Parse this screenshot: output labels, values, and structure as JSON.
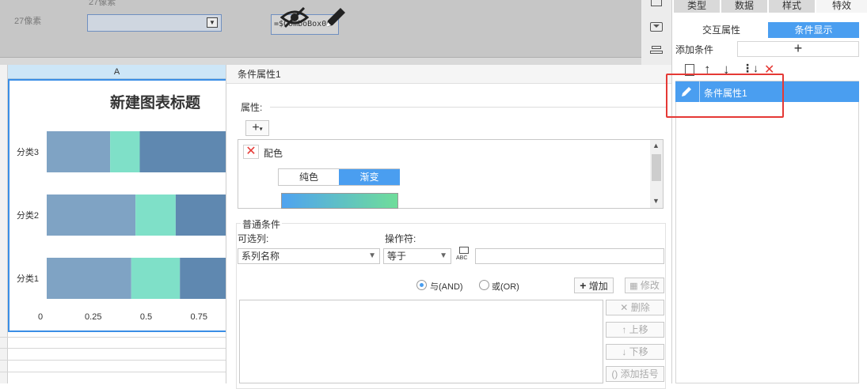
{
  "top_editor": {
    "row_height_label": "27像素",
    "top_label": "27像素",
    "combobox_value": "=$ComboBox0"
  },
  "sheet": {
    "column_header": "A"
  },
  "chart_data": {
    "type": "bar",
    "orientation": "horizontal",
    "stacked": true,
    "title": "新建图表标题",
    "categories": [
      "分类1",
      "分类2",
      "分类3"
    ],
    "x_ticks": [
      "0",
      "0.25",
      "0.5",
      "0.75"
    ],
    "xlim": [
      0,
      1
    ],
    "series": [
      {
        "values": [
          0.4,
          0.42,
          0.3
        ],
        "color": "#7fa3c4"
      },
      {
        "values": [
          0.23,
          0.19,
          0.14
        ],
        "color": "#7fe0c8"
      },
      {
        "values": [
          0.37,
          0.39,
          0.56
        ],
        "color": "#5f88b0"
      }
    ]
  },
  "dialog": {
    "title": "条件属性1",
    "attributes_label": "属性:",
    "add_icon": "plus-dropdown-icon",
    "attr_item_label": "配色",
    "color_tabs": [
      "纯色",
      "渐变"
    ],
    "gradient_colors": [
      "#4fa3f0",
      "#6fdd9a"
    ],
    "general_condition_label": "普通条件",
    "optional_column_label": "可选列:",
    "optional_column_value": "系列名称",
    "operator_label": "操作符:",
    "operator_value": "等于",
    "value_field": "",
    "radio_and": "与(AND)",
    "radio_or": "或(OR)",
    "add_button": "增加",
    "modify_button": "修改",
    "delete_button": "删除",
    "move_up_button": "上移",
    "move_down_button": "下移",
    "add_bracket_button": "添加括号"
  },
  "right_panel": {
    "top_tabs": [
      "类型",
      "数据",
      "样式",
      "特效"
    ],
    "sub_tabs": [
      "交互属性",
      "条件显示"
    ],
    "add_condition_label": "添加条件",
    "add_condition_symbol": "+",
    "list_items": [
      "条件属性1"
    ],
    "accent": "#4a9ef0",
    "highlight_color": "#e53935"
  }
}
